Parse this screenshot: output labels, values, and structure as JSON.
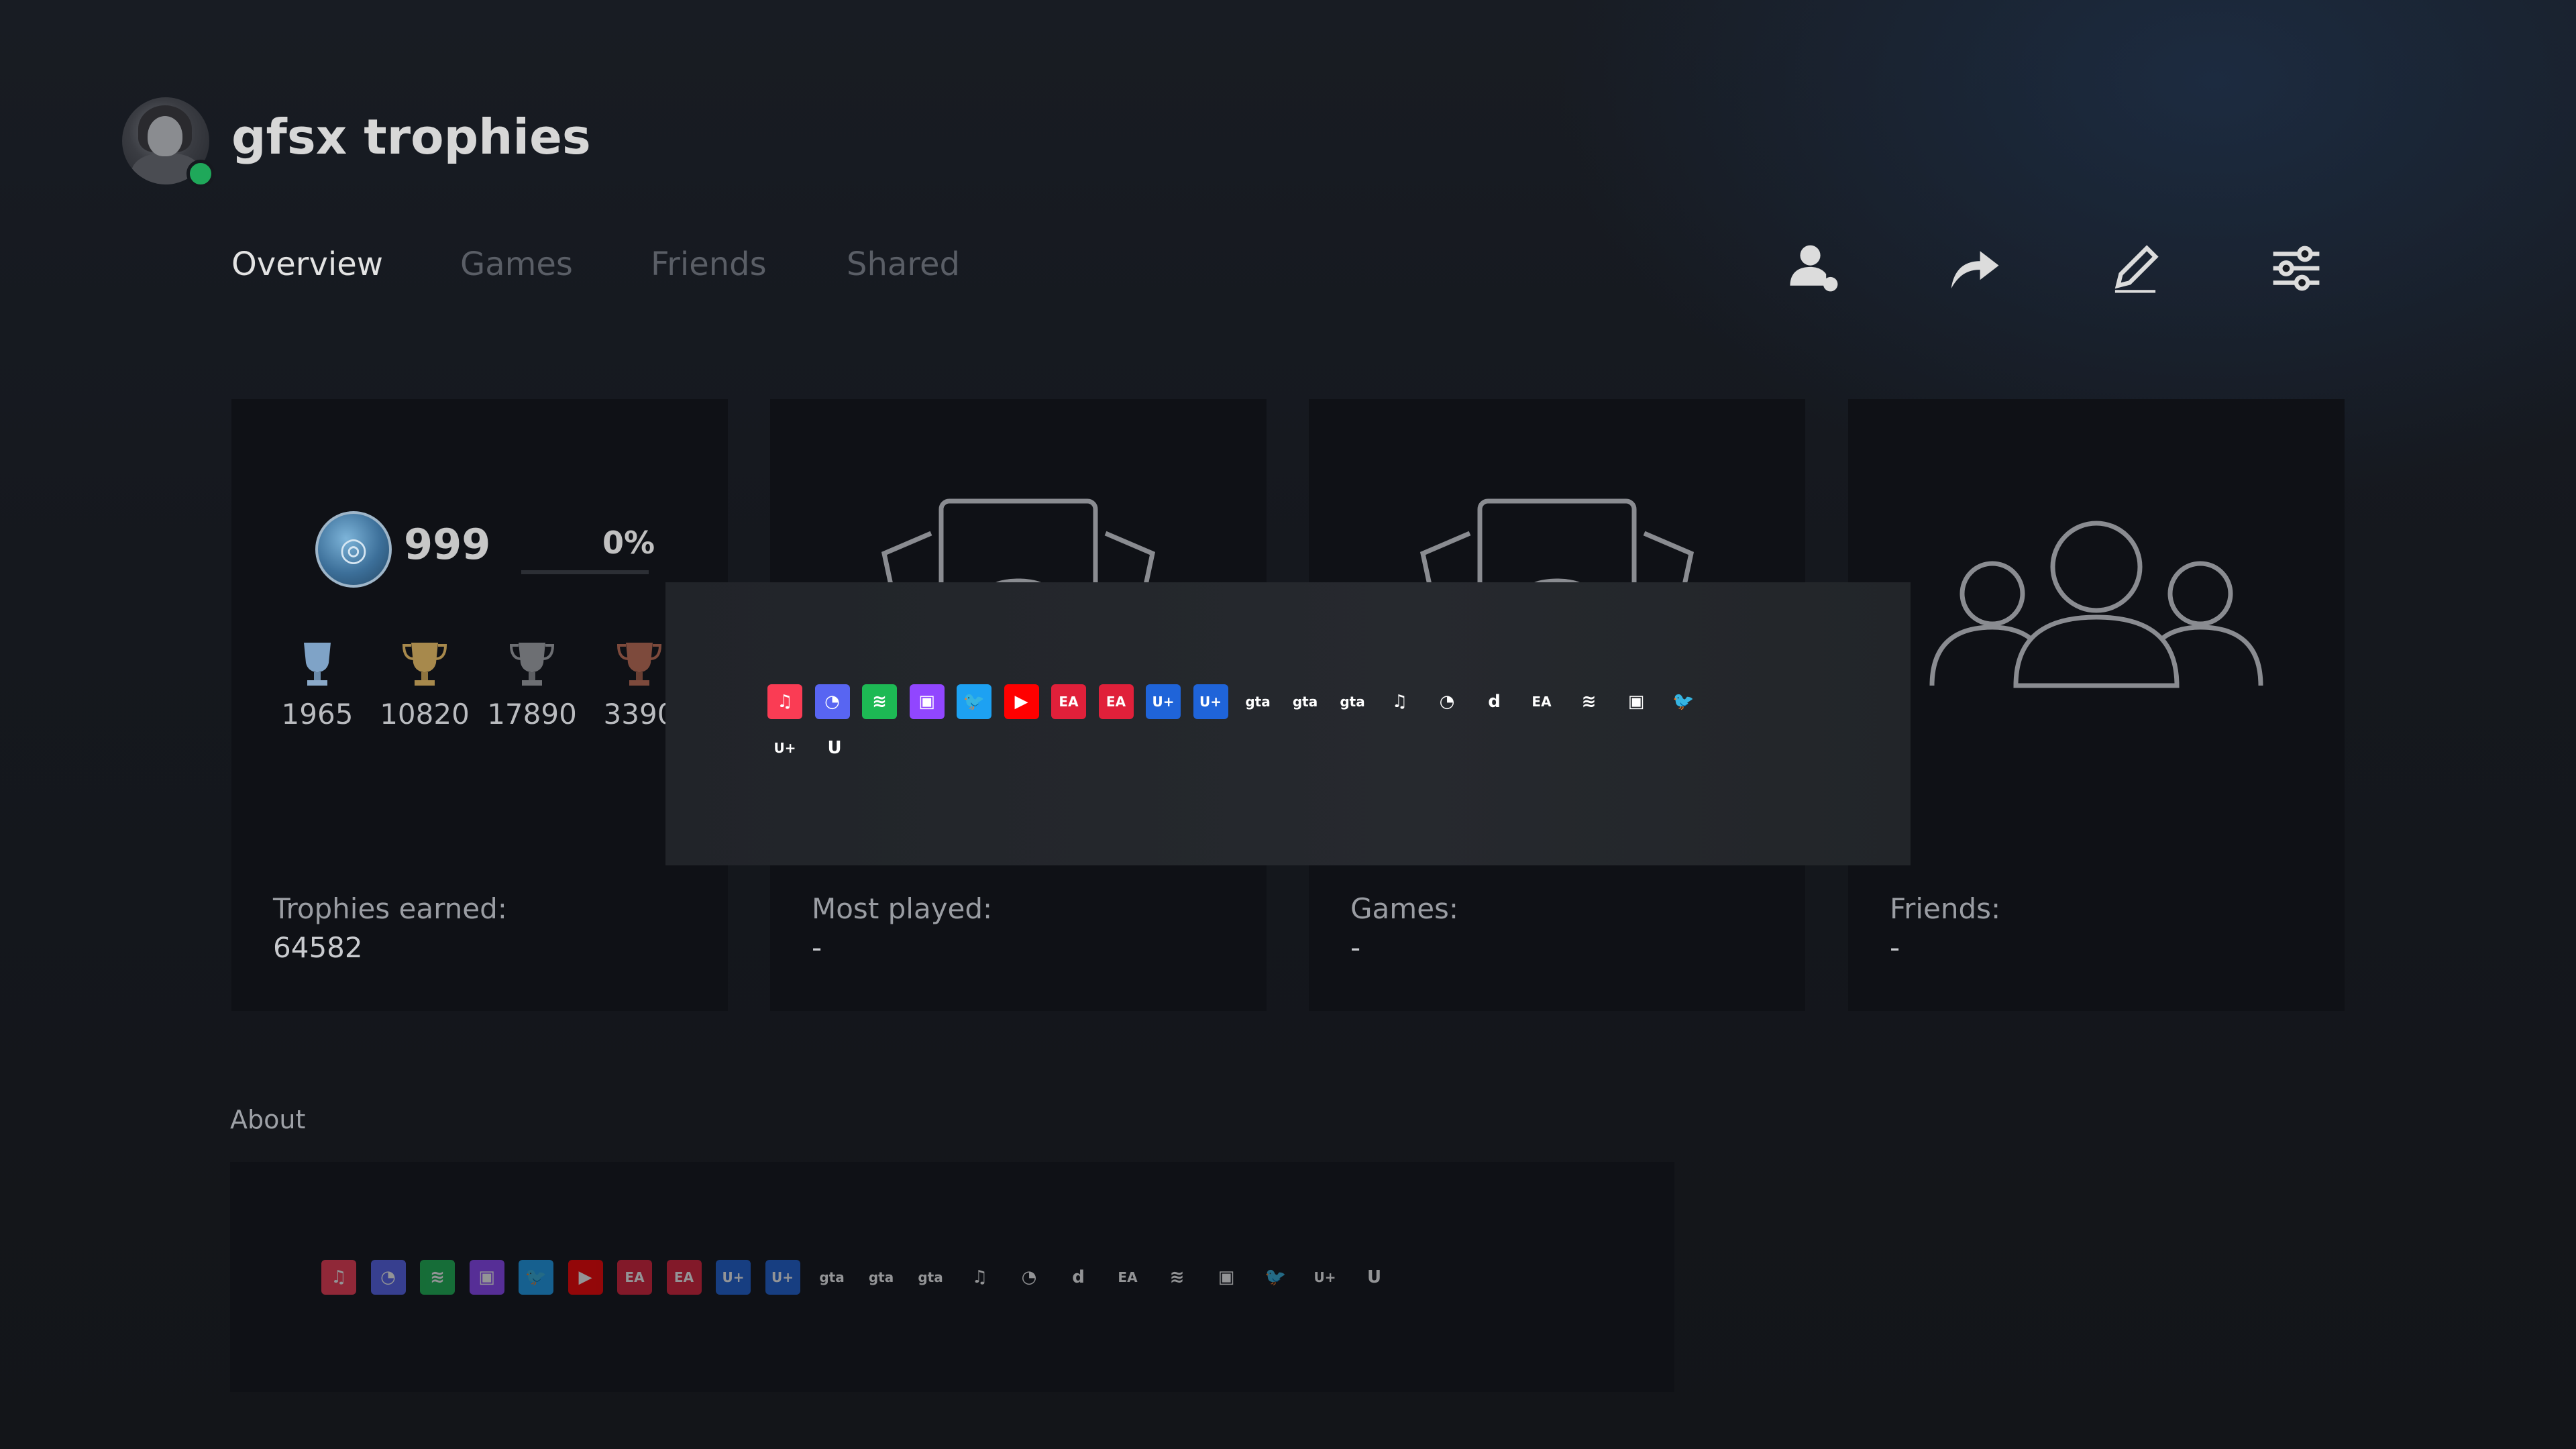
{
  "header": {
    "title": "gfsx trophies",
    "online_status": "online"
  },
  "tabs": [
    {
      "label": "Overview",
      "active": true
    },
    {
      "label": "Games",
      "active": false
    },
    {
      "label": "Friends",
      "active": false
    },
    {
      "label": "Shared",
      "active": false
    }
  ],
  "toolbar": {
    "buttons": [
      "add-friend-icon",
      "share-icon",
      "edit-icon",
      "settings-sliders-icon"
    ]
  },
  "trophy_card": {
    "level": "999",
    "progress_label": "0%",
    "progress_fraction": 0.0,
    "platinum": "1965",
    "gold": "10820",
    "silver": "17890",
    "bronze": "3390",
    "label": "Trophies earned:",
    "value": "64582"
  },
  "most_played_card": {
    "label": "Most played:",
    "value": "-"
  },
  "games_card": {
    "label": "Games:",
    "value": "-"
  },
  "friends_card": {
    "label": "Friends:",
    "value": "-"
  },
  "about": {
    "label": "About"
  },
  "overlay_icons_row1": [
    {
      "name": "apple-music-icon",
      "glyph": "♫",
      "bg": "#fa3c54"
    },
    {
      "name": "discord-icon",
      "glyph": "◔",
      "bg": "#5865f2"
    },
    {
      "name": "spotify-icon",
      "glyph": "≋",
      "bg": "#1db954"
    },
    {
      "name": "twitch-icon",
      "glyph": "▣",
      "bg": "#9146ff"
    },
    {
      "name": "twitter-icon",
      "glyph": "🐦",
      "bg": "#1da1f2"
    },
    {
      "name": "youtube-icon",
      "glyph": "▶",
      "bg": "#ff0000"
    },
    {
      "name": "ea-icon",
      "glyph": "EA",
      "bg": "#e0203a"
    },
    {
      "name": "ea-locked-icon",
      "glyph": "EA",
      "bg": "#e0203a"
    },
    {
      "name": "ubisoft-plus-icon",
      "glyph": "U+",
      "bg": "#1f64d9"
    },
    {
      "name": "ubisoft-plus-locked-icon",
      "glyph": "U+",
      "bg": "#1f64d9"
    },
    {
      "name": "gta-plus-icon",
      "glyph": "gta",
      "bg": "transparent"
    },
    {
      "name": "gta-plus-locked-icon",
      "glyph": "gta",
      "bg": "transparent"
    },
    {
      "name": "gta-plus-alt-icon",
      "glyph": "gta",
      "bg": "transparent"
    },
    {
      "name": "apple-music-mono-icon",
      "glyph": "♫",
      "bg": "transparent"
    },
    {
      "name": "discord-mono-icon",
      "glyph": "◔",
      "bg": "transparent"
    },
    {
      "name": "dazn-icon",
      "glyph": "d",
      "bg": "transparent"
    },
    {
      "name": "ea-mono-icon",
      "glyph": "EA",
      "bg": "transparent"
    },
    {
      "name": "spotify-mono-icon",
      "glyph": "≋",
      "bg": "transparent"
    },
    {
      "name": "twitch-mono-icon",
      "glyph": "▣",
      "bg": "transparent"
    },
    {
      "name": "twitter-mono-icon",
      "glyph": "🐦",
      "bg": "transparent"
    }
  ],
  "overlay_icons_row2": [
    {
      "name": "ubisoft-plus-mono-icon",
      "glyph": "U+",
      "bg": "transparent"
    },
    {
      "name": "ubisoft-mono-icon",
      "glyph": "U",
      "bg": "transparent"
    }
  ]
}
